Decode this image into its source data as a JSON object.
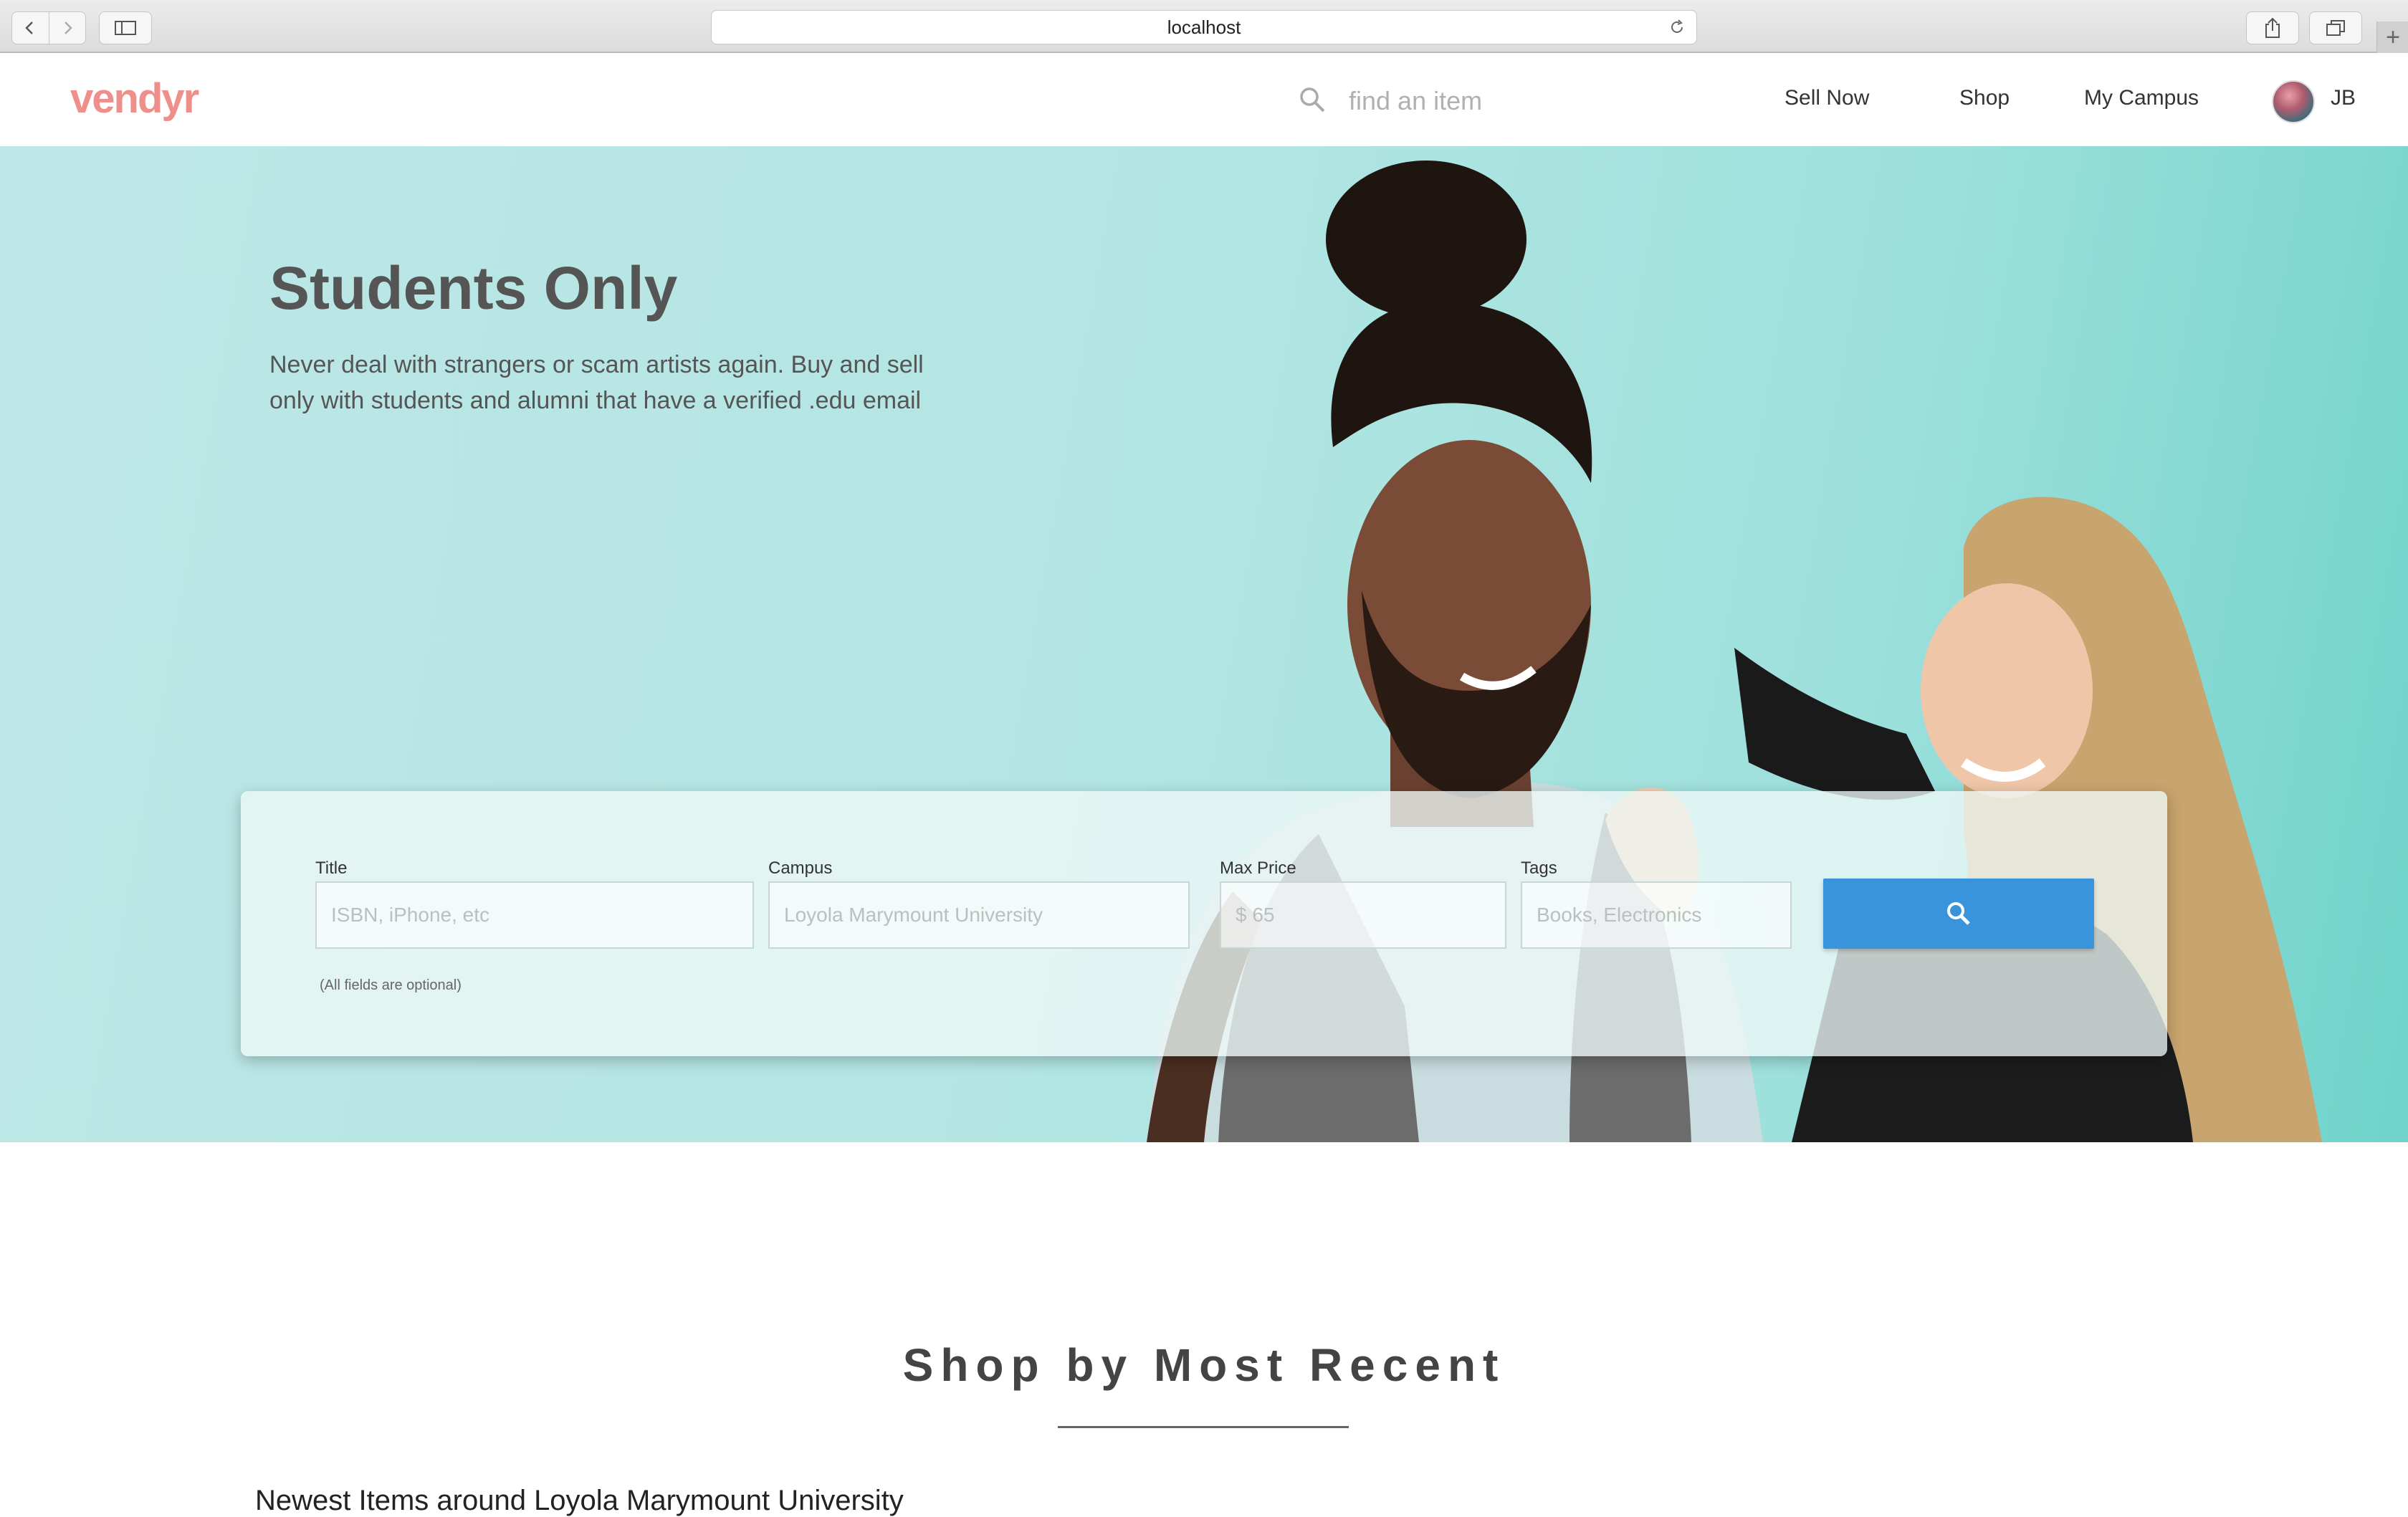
{
  "browser": {
    "url": "localhost"
  },
  "header": {
    "logo": "vendyr",
    "search_placeholder": "find an item",
    "nav": {
      "sell_now": "Sell Now",
      "shop": "Shop",
      "my_campus": "My Campus"
    },
    "user_initials": "JB"
  },
  "hero": {
    "title": "Students Only",
    "subtitle": "Never deal with strangers or scam artists again. Buy and sell only with students and alumni that have a verified .edu email"
  },
  "search_form": {
    "title_label": "Title",
    "title_placeholder": "ISBN, iPhone, etc",
    "campus_label": "Campus",
    "campus_placeholder": "Loyola Marymount University",
    "max_price_label": "Max Price",
    "max_price_placeholder": "$ 65",
    "tags_label": "Tags",
    "tags_placeholder": "Books, Electronics",
    "optional_note": "(All fields are optional)",
    "button_color": "#3a94dc"
  },
  "recent": {
    "title": "Shop by Most Recent",
    "subtitle": "Newest Items around Loyola Marymount University"
  },
  "colors": {
    "brand": "#ef8f8b",
    "hero_bg": "#b3e6e3",
    "accent": "#3a94dc"
  }
}
